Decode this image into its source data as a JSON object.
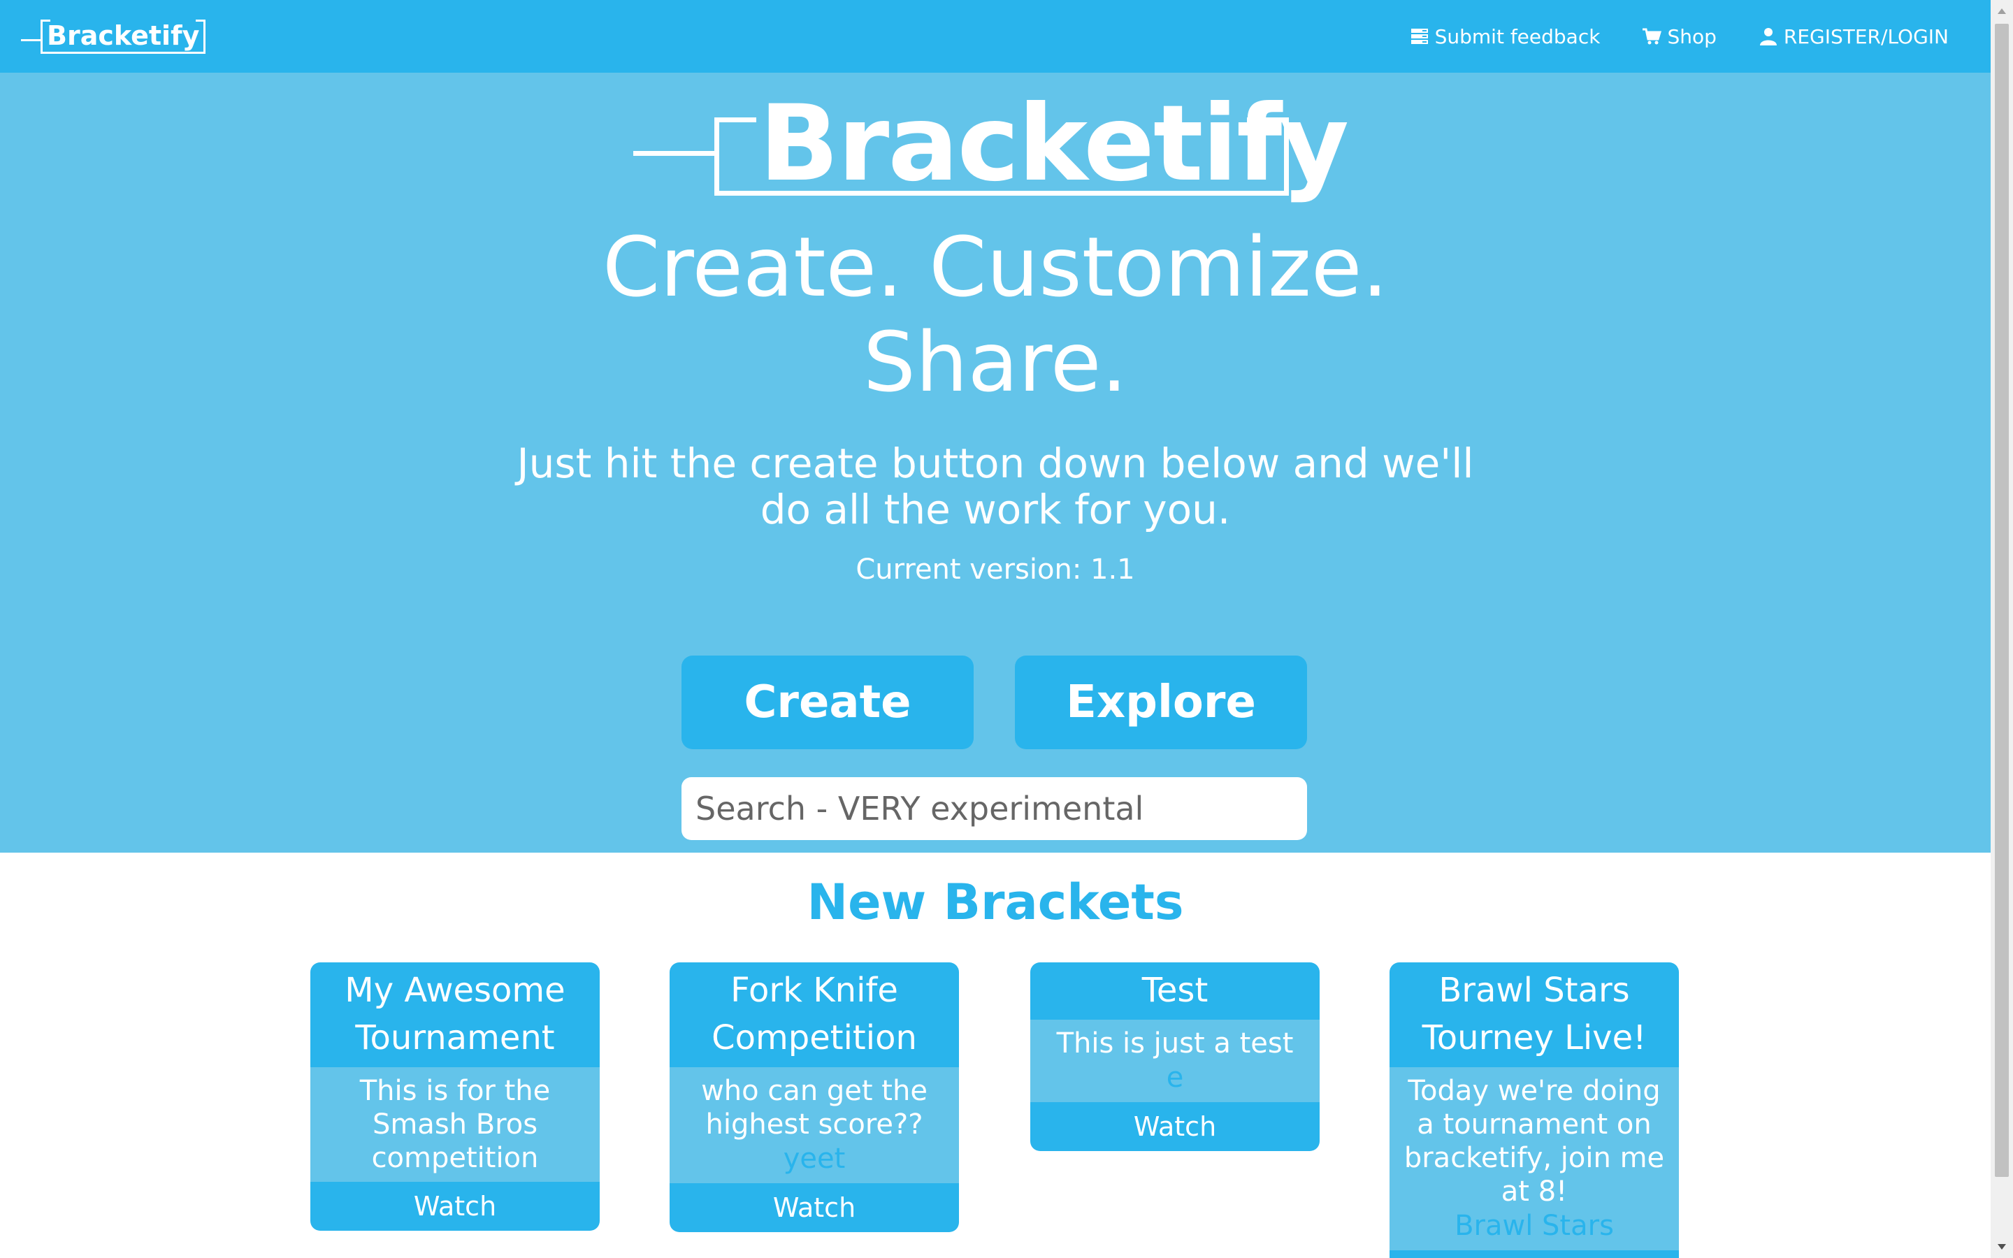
{
  "navbar": {
    "logo_text": "Bracketify",
    "links": [
      {
        "label": "Submit feedback",
        "icon": "feedback-icon"
      },
      {
        "label": "Shop",
        "icon": "cart-icon"
      },
      {
        "label": "REGISTER/LOGIN",
        "icon": "user-icon"
      }
    ]
  },
  "hero": {
    "logo_text": "Bracketify",
    "headline_line1": "Create. Customize.",
    "headline_line2": "Share.",
    "subtitle": "Just hit the create button down below and we'll do all the work for you.",
    "version": "Current version: 1.1",
    "create_label": "Create",
    "explore_label": "Explore",
    "search_placeholder": "Search - VERY experimental"
  },
  "new_brackets": {
    "title": "New Brackets",
    "cards": [
      {
        "title": "My Awesome Tournament",
        "description": "This is for the Smash Bros competition",
        "tag": "",
        "action": "Watch"
      },
      {
        "title": "Fork Knife Competition",
        "description": "who can get the highest score??",
        "tag": "yeet",
        "action": "Watch"
      },
      {
        "title": "Test",
        "description": "This is just a test",
        "tag": "e",
        "action": "Watch"
      },
      {
        "title": "Brawl Stars Tourney Live!",
        "description": "Today we're doing a tournament on bracketify, join me at 8!",
        "tag": "Brawl Stars",
        "action": ""
      }
    ]
  },
  "colors": {
    "primary": "#29b4ec",
    "hero_bg": "#63c4ea",
    "white": "#ffffff"
  }
}
